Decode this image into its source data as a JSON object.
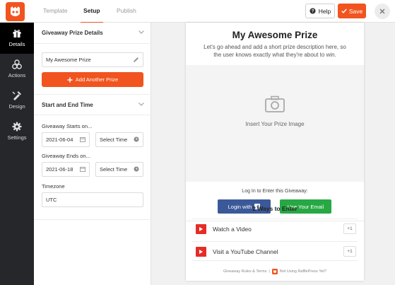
{
  "header": {
    "tabs": [
      {
        "label": "Template"
      },
      {
        "label": "Setup"
      },
      {
        "label": "Publish"
      }
    ],
    "help_label": "Help",
    "save_label": "Save"
  },
  "leftnav": {
    "items": [
      {
        "label": "Details",
        "icon": "gift-icon"
      },
      {
        "label": "Actions",
        "icon": "actions-icon"
      },
      {
        "label": "Design",
        "icon": "design-icon"
      },
      {
        "label": "Settings",
        "icon": "gear-icon"
      }
    ]
  },
  "panel": {
    "prize_section_title": "Giveaway Prize Details",
    "prize_name": "My Awesome Prize",
    "add_prize_label": "Add Another Prize",
    "time_section_title": "Start and End Time",
    "starts_label": "Giveaway Starts on...",
    "start_date": "2021-06-04",
    "start_time": "Select Time",
    "ends_label": "Giveaway Ends on...",
    "end_date": "2021-06-18",
    "end_time": "Select Time",
    "timezone_label": "Timezone",
    "timezone_value": "UTC"
  },
  "preview": {
    "title": "My Awesome Prize",
    "description": "Let's go ahead and add a short prize description here, so the user knows exactly what they're about to win.",
    "image_label": "Insert Your Prize Image",
    "login_label": "Log In to Enter this Giveaway:",
    "facebook_button": "Login with",
    "email_button": "Use Your Email",
    "ways_title": "2 Ways to Enter",
    "entries": [
      {
        "label": "Watch a Video",
        "points": "+1"
      },
      {
        "label": "Visit a YouTube Channel",
        "points": "+1"
      }
    ],
    "footer_rules": "Giveaway Rules & Terms",
    "footer_separator": "|",
    "footer_cta": "Not Using RafflePress Yet?"
  },
  "colors": {
    "accent": "#f1541e",
    "facebook": "#3b5998",
    "email": "#27a844",
    "youtube": "#e52d27",
    "nav_bg": "#26272b"
  }
}
